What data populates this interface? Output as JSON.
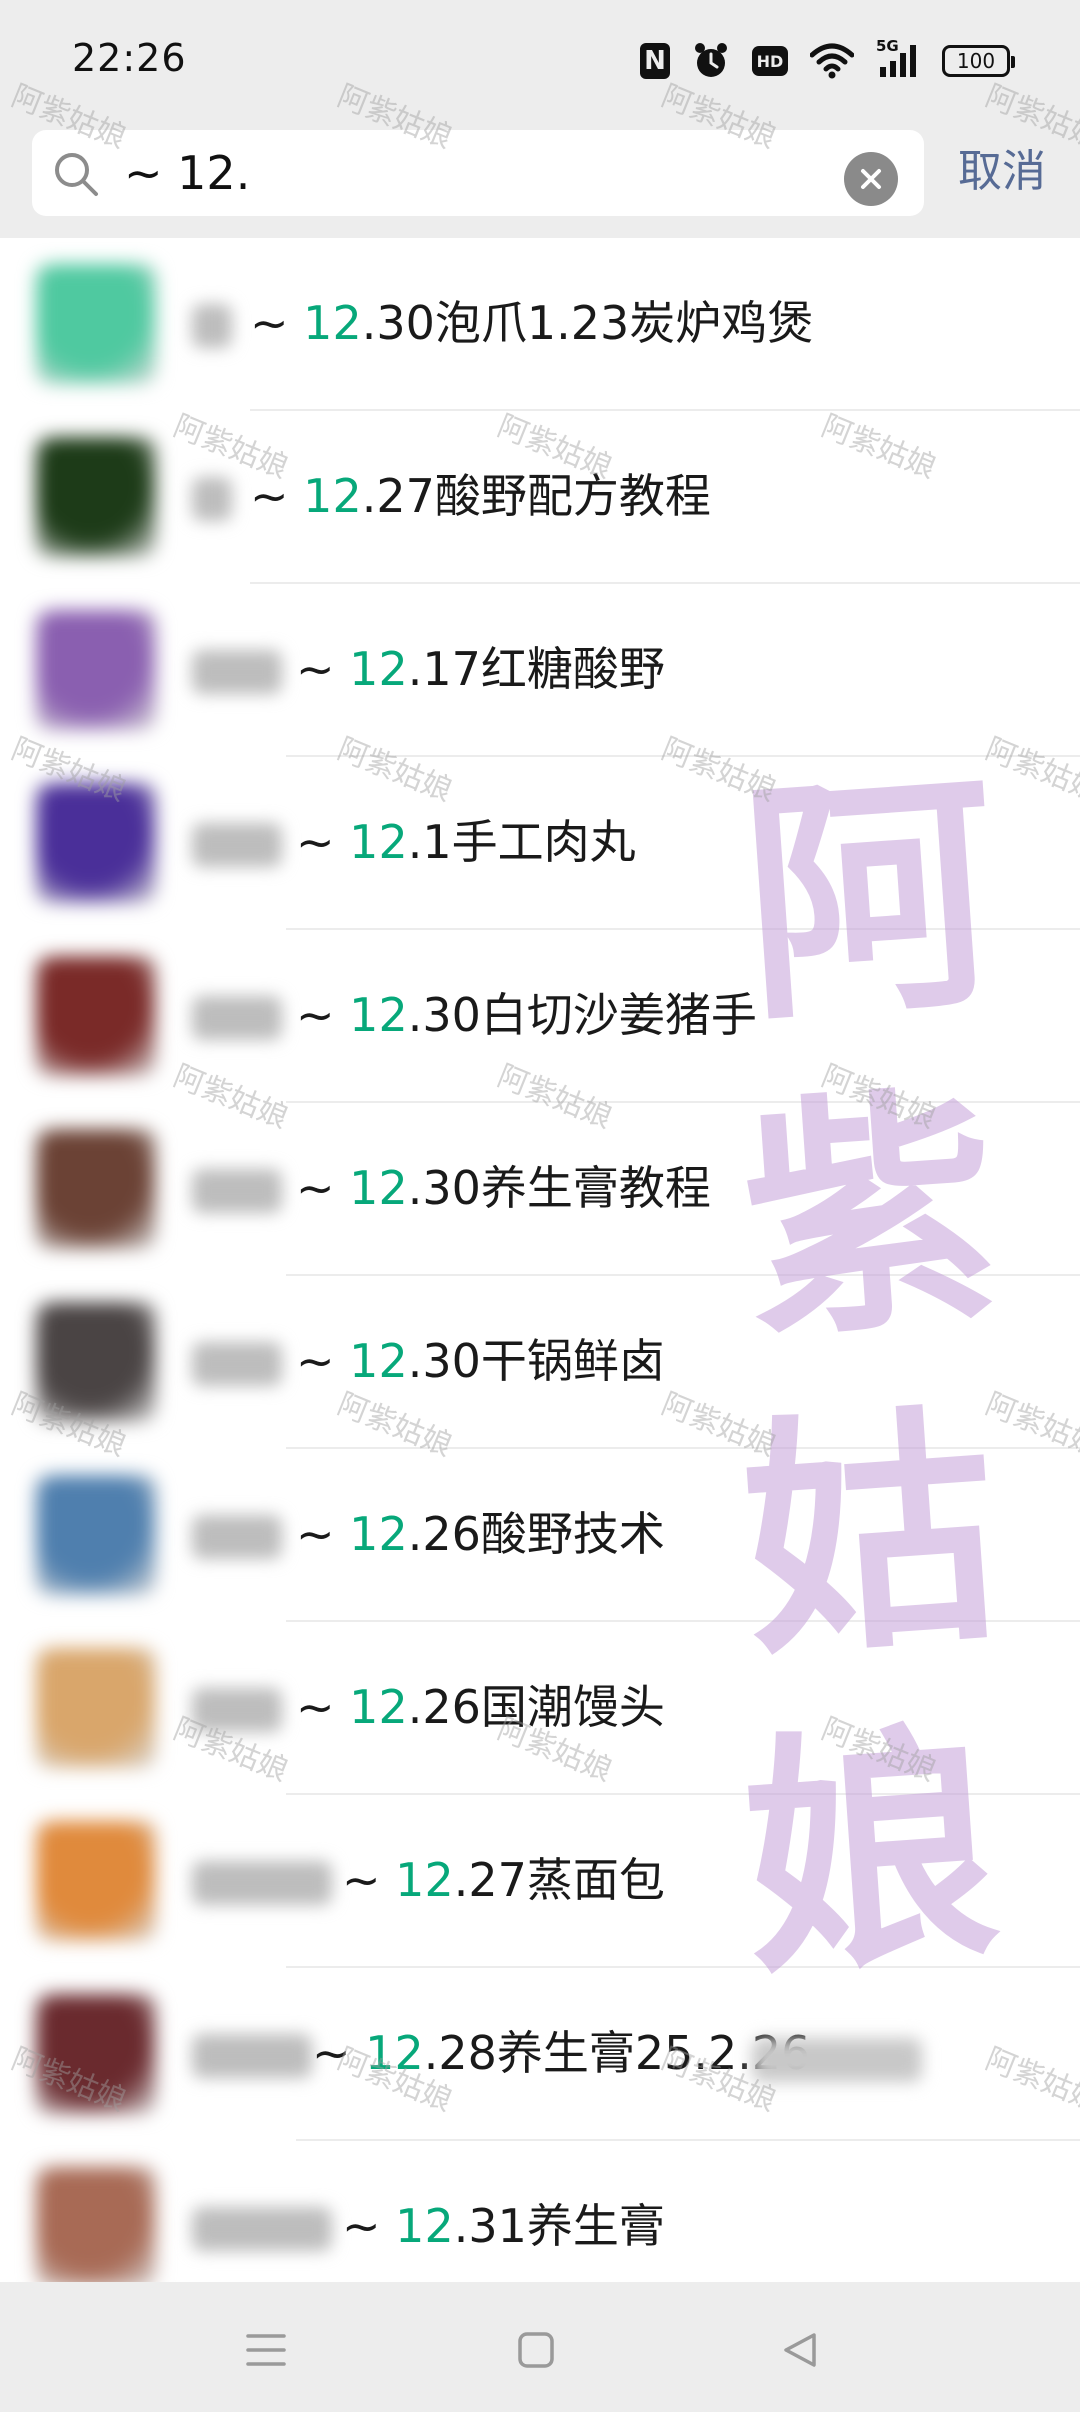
{
  "status_bar": {
    "time": "22:26",
    "nfc_letter": "N",
    "hd_label": "HD",
    "network_label": "5G",
    "battery_level": "100"
  },
  "search": {
    "query": "~ 12.",
    "cancel_label": "取消"
  },
  "results": [
    {
      "prefix": "~ ",
      "highlight": "12",
      "rest": ".30泡爪1.23炭炉鸡煲",
      "avatar_color": "#4fc9a0"
    },
    {
      "prefix": "~ ",
      "highlight": "12",
      "rest": ".27酸野配方教程",
      "avatar_color": "#1d3b18"
    },
    {
      "prefix": "~ ",
      "highlight": "12",
      "rest": ".17红糖酸野",
      "avatar_color": "#8a5fb0"
    },
    {
      "prefix": "~ ",
      "highlight": "12",
      "rest": ".1手工肉丸",
      "avatar_color": "#4a2f99"
    },
    {
      "prefix": "~ ",
      "highlight": "12",
      "rest": ".30白切沙姜猪手",
      "avatar_color": "#7a2a28"
    },
    {
      "prefix": "~ ",
      "highlight": "12",
      "rest": ".30养生膏教程",
      "avatar_color": "#6b4235"
    },
    {
      "prefix": "~ ",
      "highlight": "12",
      "rest": ".30干锅鲜卤",
      "avatar_color": "#4a4444"
    },
    {
      "prefix": "~ ",
      "highlight": "12",
      "rest": ".26酸野技术",
      "avatar_color": "#4f7fae"
    },
    {
      "prefix": "~ ",
      "highlight": "12",
      "rest": ".26国潮馒头",
      "avatar_color": "#d9a66b"
    },
    {
      "prefix": "~ ",
      "highlight": "12",
      "rest": ".27蒸面包",
      "avatar_color": "#e08a3c"
    },
    {
      "prefix": "~ ",
      "highlight": "12",
      "rest": ".28养生膏25.2.26",
      "avatar_color": "#6a2a2e"
    },
    {
      "prefix": "~ ",
      "highlight": "12",
      "rest": ".31养生膏",
      "avatar_color": "#a86a55"
    }
  ],
  "watermark": {
    "big_chars": [
      "阿",
      "紫",
      "姑",
      "娘"
    ],
    "small_text": "阿紫姑娘"
  },
  "nav_bar": {
    "icons": [
      "menu-icon",
      "home-square-icon",
      "back-triangle-icon"
    ]
  }
}
